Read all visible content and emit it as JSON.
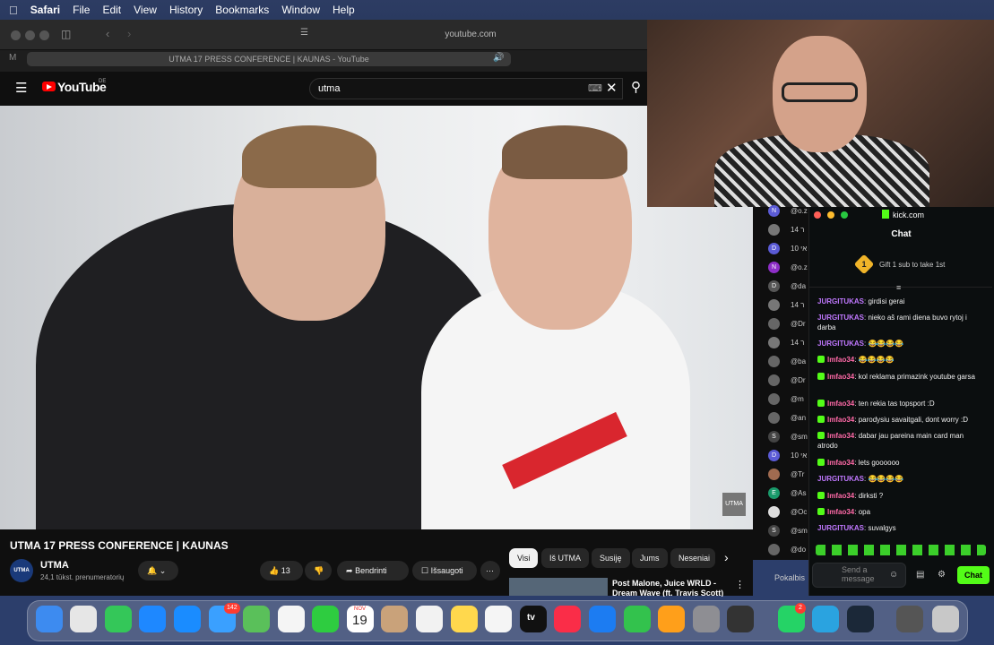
{
  "menubar": {
    "apple": "",
    "items": [
      "Safari",
      "File",
      "Edit",
      "View",
      "History",
      "Bookmarks",
      "Window",
      "Help"
    ]
  },
  "safari": {
    "address": "youtube.com",
    "tab_title": "UTMA 17 PRESS CONFERENCE | KAUNAS - YouTube"
  },
  "youtube": {
    "logo": "YouTube",
    "region": "DE",
    "search_value": "utma",
    "video_title": "UTMA 17 PRESS CONFERENCE | KAUNAS",
    "channel": {
      "name": "UTMA",
      "subs": "24,1 tūkst. prenumeratorių",
      "avatar": "UTMA"
    },
    "likes": "13",
    "share": "Bendrinti",
    "save": "Išsaugoti",
    "watermark": "UTMA",
    "chips": [
      "Visi",
      "Iš UTMA",
      "Susiję",
      "Jums",
      "Neseniai"
    ],
    "related_title": "Post Malone, Juice WRLD - Dream Wave (ft. Travis Scott) |"
  },
  "sidelist": {
    "items": [
      {
        "avatar": "N",
        "text": "@o.z",
        "color": "#5b5bd6"
      },
      {
        "avatar": "",
        "text": "14 ר",
        "color": "#777"
      },
      {
        "avatar": "D",
        "text": "10 אי",
        "color": "#5b5bd6"
      },
      {
        "avatar": "N",
        "text": "@o.z",
        "color": "#8e2ec7"
      },
      {
        "avatar": "D",
        "text": "@da",
        "color": "#555"
      },
      {
        "avatar": "",
        "text": "14 ר",
        "color": "#777"
      },
      {
        "avatar": "",
        "text": "@Dr",
        "color": "#666"
      },
      {
        "avatar": "",
        "text": "14 ר",
        "color": "#777"
      },
      {
        "avatar": "",
        "text": "@ba",
        "color": "#666"
      },
      {
        "avatar": "",
        "text": "@Dr",
        "color": "#666"
      },
      {
        "avatar": "",
        "text": "@m",
        "color": "#666"
      },
      {
        "avatar": "",
        "text": "@an",
        "color": "#666"
      },
      {
        "avatar": "S",
        "text": "@sm",
        "color": "#444"
      },
      {
        "avatar": "D",
        "text": "10 אי",
        "color": "#5b5bd6"
      },
      {
        "avatar": "",
        "text": "@Tr",
        "color": "#a06b50"
      },
      {
        "avatar": "E",
        "text": "@As",
        "color": "#1a9a6b"
      },
      {
        "avatar": "",
        "text": "@Oc",
        "color": "#ddd"
      },
      {
        "avatar": "S",
        "text": "@sm",
        "color": "#444"
      },
      {
        "avatar": "",
        "text": "@do",
        "color": "#666"
      }
    ]
  },
  "kick": {
    "site": "kick.com",
    "title": "Chat",
    "gift_num": "1",
    "gift_text": "Gift 1 sub to take 1st",
    "messages": [
      {
        "user": "JURGITUKAS",
        "text": "girdisi gerai",
        "type": "u1"
      },
      {
        "user": "JURGITUKAS",
        "text": "nieko aš rami diena buvo rytoj i darba",
        "type": "u1"
      },
      {
        "user": "JURGITUKAS",
        "text": "😂😂😂😂",
        "type": "u1"
      },
      {
        "user": "lmfao34",
        "text": "😂😂😂😂",
        "type": "u2"
      },
      {
        "user": "lmfao34",
        "text": "kol reklama primazink youtube garsa",
        "type": "u2"
      },
      {
        "user": "lmfao34",
        "text": "ten rekia tas topsport :D",
        "type": "u2"
      },
      {
        "user": "lmfao34",
        "text": "parodysiu savaitgali, dont worry :D",
        "type": "u2"
      },
      {
        "user": "lmfao34",
        "text": "dabar jau pareina main card man atrodo",
        "type": "u2"
      },
      {
        "user": "lmfao34",
        "text": "lets goooooo",
        "type": "u2"
      },
      {
        "user": "JURGITUKAS",
        "text": "😂😂😂😂",
        "type": "u1"
      },
      {
        "user": "lmfao34",
        "text": "dirksti ?",
        "type": "u2"
      },
      {
        "user": "lmfao34",
        "text": "opa",
        "type": "u2"
      },
      {
        "user": "JURGITUKAS",
        "text": "suvalgys",
        "type": "u1"
      }
    ],
    "input_placeholder": "Send a message",
    "chat_button": "Chat",
    "side_label": "Pokalbis"
  },
  "dock": {
    "mail_badge": "142",
    "calendar_day": "19",
    "calendar_month": "NOV",
    "whatsapp_badge": "2",
    "tv_label": "tv"
  }
}
